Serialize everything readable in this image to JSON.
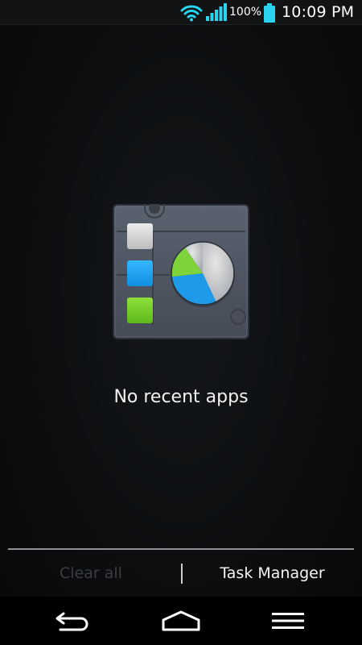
{
  "status_bar": {
    "battery_percent": "100%",
    "time": "10:09 PM",
    "battery_level": 1.0,
    "signal_bars": 5,
    "icons": [
      "wifi-icon",
      "signal-icon",
      "battery-icon"
    ]
  },
  "recents": {
    "empty_message": "No recent apps",
    "empty_icon": "task-manager-icon"
  },
  "action_bar": {
    "clear_all_label": "Clear all",
    "task_manager_label": "Task Manager"
  },
  "nav_bar": {
    "icons": [
      "back-icon",
      "home-icon",
      "menu-icon"
    ]
  },
  "colors": {
    "accent": "#2ad4f0",
    "disabled_text": "#3a3e42",
    "active_text": "#f4f4f4"
  }
}
